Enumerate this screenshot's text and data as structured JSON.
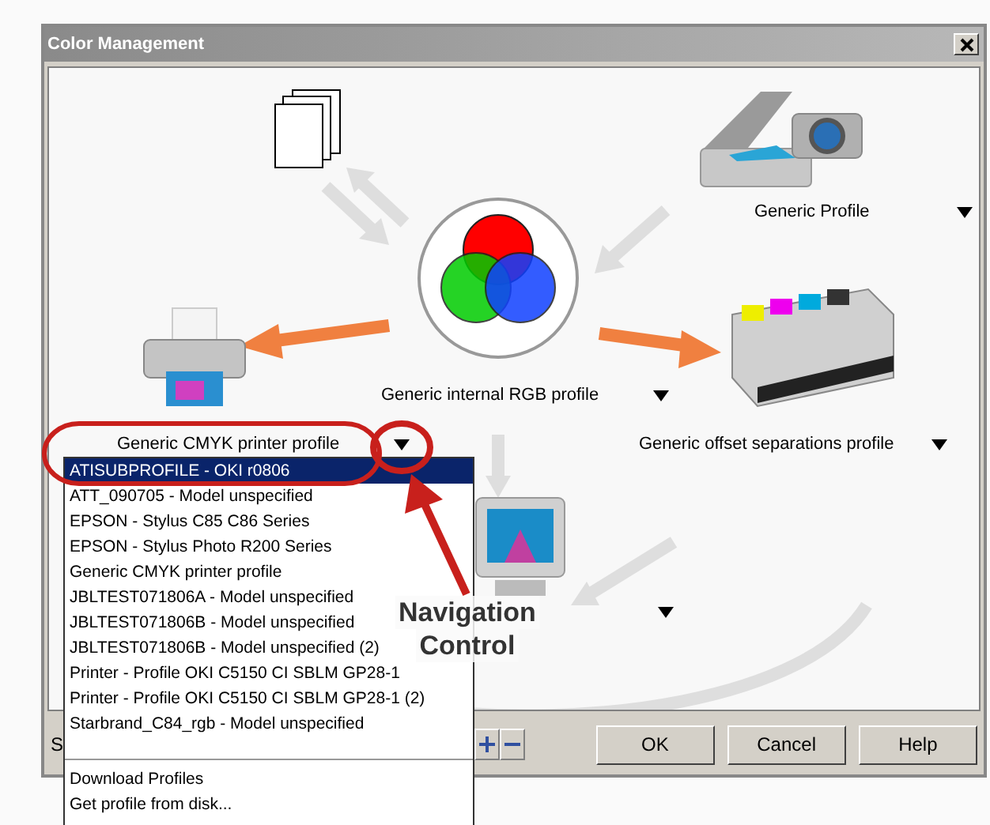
{
  "window": {
    "title": "Color Management"
  },
  "profiles": [
    {
      "kind": "scanner",
      "label": "Generic Profile"
    },
    {
      "kind": "rgb",
      "label": "Generic internal RGB profile"
    },
    {
      "kind": "printer",
      "label": "Generic CMYK printer profile"
    },
    {
      "kind": "press",
      "label": "Generic offset separations profile"
    },
    {
      "kind": "monitor"
    }
  ],
  "dropdown": {
    "items": [
      {
        "label": "ATISUBPROFILE - OKI r0806",
        "selected": true
      },
      {
        "label": "ATT_090705 - Model unspecified",
        "selected": false
      },
      {
        "label": "EPSON - Stylus C85 C86 Series",
        "selected": false
      },
      {
        "label": "EPSON - Stylus Photo R200 Series",
        "selected": false
      },
      {
        "label": "Generic CMYK printer profile",
        "selected": false
      },
      {
        "label": "JBLTEST071806A - Model unspecified",
        "selected": false
      },
      {
        "label": "JBLTEST071806B - Model unspecified",
        "selected": false
      },
      {
        "label": "JBLTEST071806B - Model unspecified (2)",
        "selected": false
      },
      {
        "label": "Printer - Profile OKI C5150 CI SBLM GP28-1",
        "selected": false
      },
      {
        "label": "Printer - Profile OKI C5150 CI SBLM GP28-1 (2)",
        "selected": false
      },
      {
        "label": "Starbrand_C84_rgb - Model unspecified",
        "selected": false
      }
    ],
    "actions": [
      "Download Profiles",
      "Get profile from disk..."
    ]
  },
  "bottom_bar": {
    "label_fragment": "S",
    "buttons": [
      "OK",
      "Cancel",
      "Help"
    ]
  },
  "annotation": {
    "lines": [
      "Navigation",
      "Control"
    ]
  }
}
